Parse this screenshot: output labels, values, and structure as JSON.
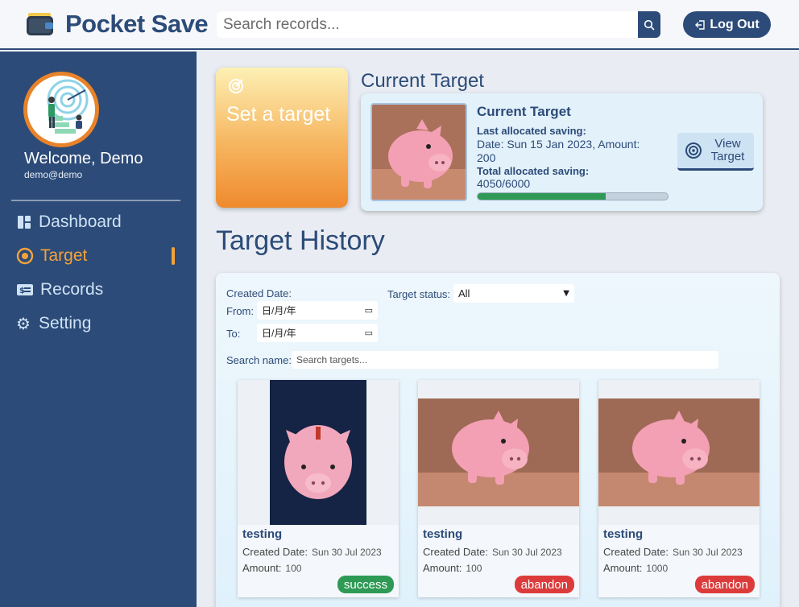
{
  "header": {
    "app_name": "Pocket Save",
    "search_placeholder": "Search records...",
    "logout_label": "Log Out"
  },
  "sidebar": {
    "welcome": "Welcome, Demo",
    "email": "demo@demo",
    "items": [
      {
        "label": "Dashboard",
        "icon": "dashboard-icon",
        "active": false
      },
      {
        "label": "Target",
        "icon": "target-icon",
        "active": true
      },
      {
        "label": "Records",
        "icon": "records-icon",
        "active": false
      },
      {
        "label": "Setting",
        "icon": "gear-icon",
        "active": false
      }
    ]
  },
  "set_target": {
    "label": "Set a target"
  },
  "current_target": {
    "heading": "Current Target",
    "card_title": "Current Target",
    "last_label": "Last allocated saving:",
    "last_value": "Date: Sun 15 Jan 2023, Amount: 200",
    "total_label": "Total allocated saving:",
    "total_value": "4050/6000",
    "progress_fraction": 0.675,
    "view_button": "View Target"
  },
  "target_history": {
    "heading": "Target History",
    "created_date_label": "Created Date:",
    "from_label": "From:",
    "to_label": "To:",
    "date_placeholder": "日/月/年",
    "status_label": "Target status:",
    "status_value": "All",
    "search_name_label": "Search name:",
    "search_name_placeholder": "Search targets...",
    "created_row_label": "Created Date:",
    "amount_row_label": "Amount:",
    "cards": [
      {
        "name": "testing",
        "created": "Sun 30 Jul 2023",
        "amount": "100",
        "status": "success",
        "status_color": "#2e9a55"
      },
      {
        "name": "testing",
        "created": "Sun 30 Jul 2023",
        "amount": "100",
        "status": "abandon",
        "status_color": "#dc3b3b"
      },
      {
        "name": "testing",
        "created": "Sun 30 Jul 2023",
        "amount": "1000",
        "status": "abandon",
        "status_color": "#dc3b3b"
      }
    ]
  },
  "colors": {
    "primary": "#2c4b78",
    "accent": "#f3a23b",
    "success": "#2e9a55",
    "danger": "#dc3b3b"
  }
}
